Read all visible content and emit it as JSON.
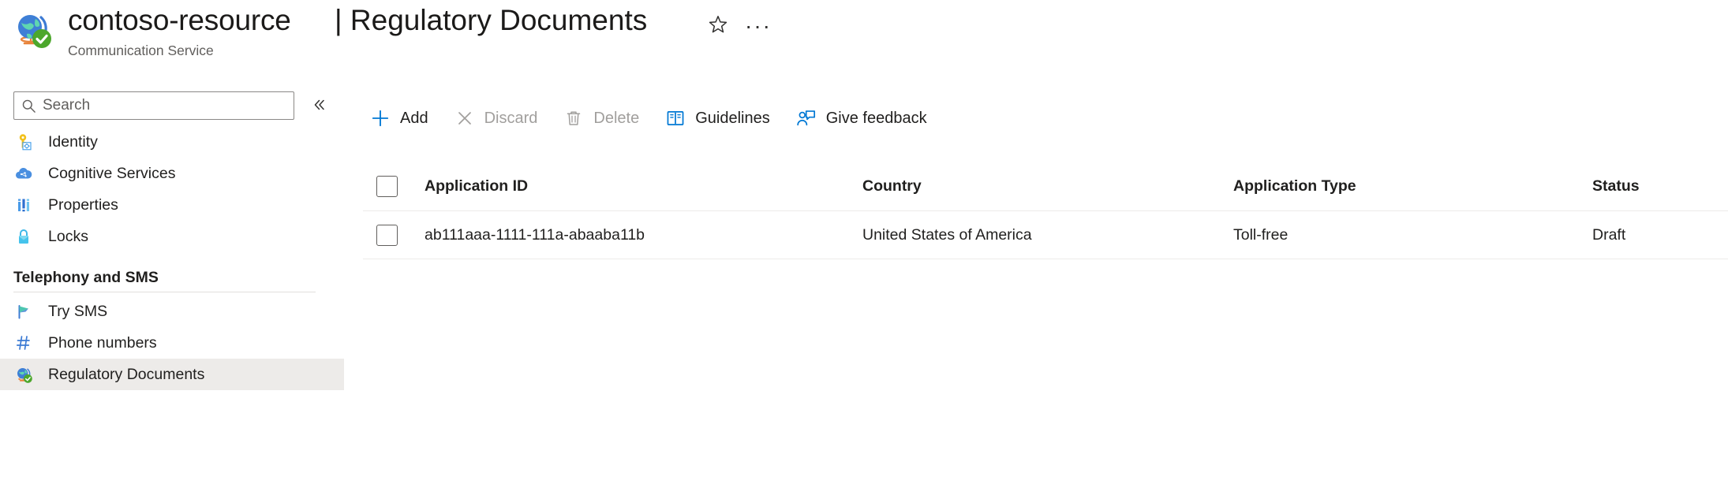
{
  "header": {
    "resource_icon": "globe-check-icon",
    "resource_name": "contoso-resource",
    "resource_type": "Communication Service",
    "page_title": "| Regulatory Documents",
    "favorite_icon": "star-icon",
    "more_icon": "ellipsis-icon",
    "more_label": "···"
  },
  "sidebar": {
    "search": {
      "placeholder": "Search",
      "value": "",
      "icon": "search-icon"
    },
    "collapse_icon": "chevron-double-left-icon",
    "items": [
      {
        "label": "Identity",
        "icon": "key-icon",
        "selected": false
      },
      {
        "label": "Cognitive Services",
        "icon": "cloud-icon",
        "selected": false
      },
      {
        "label": "Properties",
        "icon": "properties-bars-icon",
        "selected": false
      },
      {
        "label": "Locks",
        "icon": "lock-icon",
        "selected": false
      }
    ],
    "section": {
      "label": "Telephony and SMS",
      "items": [
        {
          "label": "Try SMS",
          "icon": "flag-icon",
          "selected": false
        },
        {
          "label": "Phone numbers",
          "icon": "hash-icon",
          "selected": false
        },
        {
          "label": "Regulatory Documents",
          "icon": "globe-check-icon",
          "selected": true
        }
      ]
    }
  },
  "toolbar": {
    "buttons": [
      {
        "label": "Add",
        "icon": "plus-icon",
        "enabled": true
      },
      {
        "label": "Discard",
        "icon": "cross-icon",
        "enabled": false
      },
      {
        "label": "Delete",
        "icon": "trash-icon",
        "enabled": false
      },
      {
        "label": "Guidelines",
        "icon": "book-icon",
        "enabled": true
      },
      {
        "label": "Give feedback",
        "icon": "feedback-person-icon",
        "enabled": true
      }
    ]
  },
  "table": {
    "select_all_checkbox": false,
    "columns": [
      "Application ID",
      "Country",
      "Application Type",
      "Status"
    ],
    "rows": [
      {
        "selected": false,
        "application_id": "ab111aaa-1111-111a-abaaba11b",
        "country": "United States of America",
        "application_type": "Toll-free",
        "status": "Draft"
      }
    ]
  },
  "colors": {
    "accent": "#0078d4",
    "selected_nav_bg": "#edebe9",
    "disabled_text": "#a19f9d",
    "text": "#201f1e",
    "subtle_text": "#605e5c"
  }
}
